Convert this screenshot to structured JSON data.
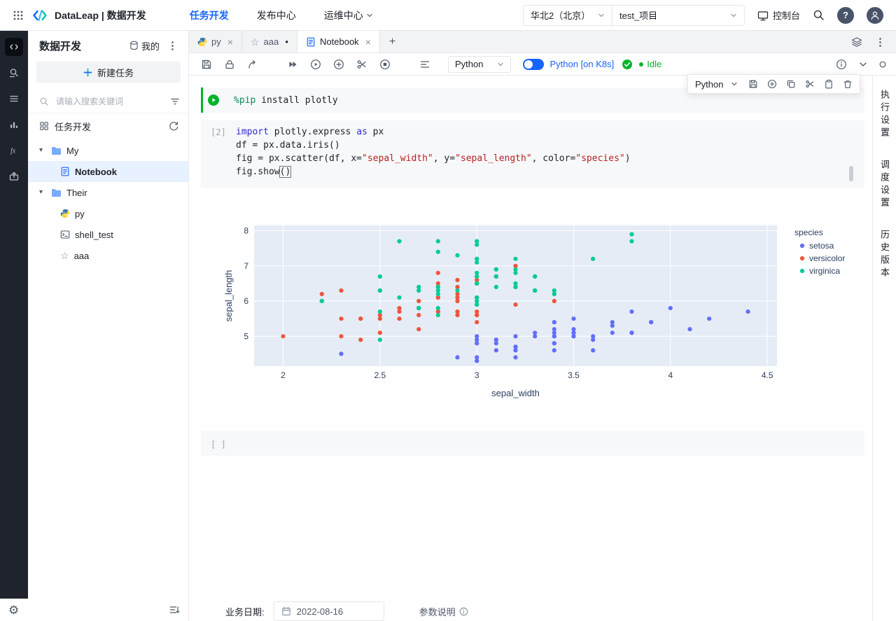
{
  "header": {
    "title": "DataLeap | 数据开发",
    "nav": [
      {
        "label": "任务开发"
      },
      {
        "label": "发布中心"
      },
      {
        "label": "运维中心"
      }
    ],
    "region": "华北2（北京）",
    "project": "test_项目",
    "console": "控制台"
  },
  "sidebar": {
    "title": "数据开发",
    "mine": "我的",
    "new_task": "新建任务",
    "search_placeholder": "请输入搜索关键词",
    "section": "任务开发",
    "tree": {
      "folder1": "My",
      "notebook": "Notebook",
      "folder2": "Their",
      "py": "py",
      "shell": "shell_test",
      "aaa": "aaa"
    }
  },
  "tabs": {
    "py": "py",
    "aaa": "aaa",
    "notebook": "Notebook"
  },
  "toolbar": {
    "kernel": "Python",
    "k8s": "Python [on K8s]",
    "status": "Idle"
  },
  "cell_toolbar": {
    "kernel": "Python"
  },
  "cells": {
    "c1": {
      "tokens": [
        {
          "t": "%pip",
          "c": "magic"
        },
        {
          "t": " install plotly",
          "c": "plain"
        }
      ]
    },
    "c2": {
      "gutter": "[2]",
      "lines": [
        [
          {
            "t": "import",
            "c": "kw"
          },
          {
            "t": " plotly.express ",
            "c": "plain"
          },
          {
            "t": "as",
            "c": "kw"
          },
          {
            "t": " px",
            "c": "plain"
          }
        ],
        [
          {
            "t": "df = px.data.iris()",
            "c": "plain"
          }
        ],
        [
          {
            "t": "fig = px.scatter(df, x=",
            "c": "plain"
          },
          {
            "t": "\"sepal_width\"",
            "c": "str"
          },
          {
            "t": ", y=",
            "c": "plain"
          },
          {
            "t": "\"sepal_length\"",
            "c": "str"
          },
          {
            "t": ", color=",
            "c": "plain"
          },
          {
            "t": "\"species\"",
            "c": "str"
          },
          {
            "t": ")",
            "c": "plain"
          }
        ],
        [
          {
            "t": "fig.show",
            "c": "plain"
          },
          {
            "t": "()",
            "c": "cursor"
          }
        ]
      ]
    },
    "empty_gutter": "[ ]"
  },
  "footer": {
    "date_label": "业务日期:",
    "date_value": "2022-08-16",
    "params": "参数说明"
  },
  "right_panel": {
    "exec": "执行设置",
    "sched": "调度设置",
    "history": "历史版本"
  },
  "icons": {
    "caret": "▾",
    "star": "☆",
    "kebab": "⋮",
    "close": "×",
    "plus": "+",
    "dot": "●",
    "gear": "⚙"
  },
  "colors": {
    "accent_blue": "#1664FF",
    "status_green": "#00B42A"
  },
  "chart_data": {
    "type": "scatter",
    "xlabel": "sepal_width",
    "ylabel": "sepal_length",
    "xlim": [
      1.85,
      4.55
    ],
    "ylim": [
      4.15,
      8.15
    ],
    "xticks": [
      2,
      2.5,
      3,
      3.5,
      4,
      4.5
    ],
    "yticks": [
      5,
      6,
      7,
      8
    ],
    "legend_title": "species",
    "background": "#E5ECF6",
    "grid": true,
    "legend_position": "right",
    "series": [
      {
        "name": "setosa",
        "color": "#636EFA",
        "x": [
          3.5,
          3.0,
          3.2,
          3.1,
          3.6,
          3.9,
          3.4,
          3.4,
          2.9,
          3.1,
          3.7,
          3.4,
          3.0,
          3.0,
          4.0,
          4.4,
          3.9,
          3.5,
          3.8,
          3.8,
          3.4,
          3.7,
          3.6,
          3.3,
          3.4,
          3.0,
          3.4,
          3.5,
          3.4,
          3.2,
          3.1,
          3.4,
          4.1,
          4.2,
          3.1,
          3.2,
          3.5,
          3.6,
          3.0,
          3.4,
          3.5,
          2.3,
          3.2,
          3.5,
          3.8,
          3.0,
          3.8,
          3.2,
          3.7,
          3.3
        ],
        "y": [
          5.1,
          4.9,
          4.7,
          4.6,
          5.0,
          5.4,
          4.6,
          5.0,
          4.4,
          4.9,
          5.4,
          4.8,
          4.8,
          4.3,
          5.8,
          5.7,
          5.4,
          5.1,
          5.7,
          5.1,
          5.4,
          5.1,
          4.6,
          5.1,
          4.8,
          5.0,
          5.0,
          5.2,
          5.2,
          4.7,
          4.8,
          5.4,
          5.2,
          5.5,
          4.9,
          5.0,
          5.5,
          4.9,
          4.4,
          5.1,
          5.0,
          4.5,
          4.4,
          5.0,
          5.1,
          4.8,
          5.1,
          4.6,
          5.3,
          5.0
        ]
      },
      {
        "name": "versicolor",
        "color": "#EF553B",
        "x": [
          3.2,
          3.2,
          3.1,
          2.3,
          2.8,
          2.8,
          3.3,
          2.4,
          2.9,
          2.7,
          2.0,
          3.0,
          2.2,
          2.9,
          2.9,
          3.1,
          3.0,
          2.7,
          2.2,
          2.5,
          3.2,
          2.8,
          2.5,
          2.8,
          2.9,
          3.0,
          2.8,
          3.0,
          2.9,
          2.6,
          2.4,
          2.4,
          2.7,
          2.7,
          3.0,
          3.4,
          3.1,
          2.3,
          3.0,
          2.5,
          2.6,
          3.0,
          2.6,
          2.3,
          2.7,
          3.0,
          2.9,
          2.9,
          2.5,
          2.8
        ],
        "y": [
          7.0,
          6.4,
          6.9,
          5.5,
          6.5,
          5.7,
          6.3,
          4.9,
          6.6,
          5.2,
          5.0,
          5.9,
          6.0,
          6.1,
          5.6,
          6.7,
          5.6,
          5.8,
          6.2,
          5.6,
          5.9,
          6.1,
          6.3,
          6.1,
          6.4,
          6.6,
          6.8,
          6.7,
          6.0,
          5.7,
          5.5,
          5.5,
          5.8,
          6.0,
          5.4,
          6.0,
          6.7,
          6.3,
          5.6,
          5.5,
          5.5,
          6.1,
          5.8,
          5.0,
          5.6,
          5.7,
          5.7,
          6.2,
          5.1,
          5.7
        ]
      },
      {
        "name": "virginica",
        "color": "#00CC96",
        "x": [
          3.3,
          2.7,
          3.0,
          2.9,
          3.0,
          3.0,
          2.5,
          2.9,
          2.5,
          3.6,
          3.2,
          2.7,
          3.0,
          2.5,
          2.8,
          3.2,
          3.0,
          3.8,
          2.6,
          2.2,
          3.2,
          2.8,
          2.8,
          2.7,
          3.3,
          3.2,
          2.8,
          3.0,
          2.8,
          3.0,
          2.8,
          3.8,
          2.8,
          2.8,
          2.6,
          3.0,
          3.4,
          3.1,
          3.0,
          3.1,
          3.1,
          3.1,
          2.7,
          3.2,
          3.3,
          3.0,
          2.5,
          3.0,
          3.4,
          3.0
        ],
        "y": [
          6.3,
          5.8,
          7.1,
          6.3,
          6.5,
          7.6,
          4.9,
          7.3,
          6.7,
          7.2,
          6.5,
          6.4,
          6.8,
          5.7,
          5.8,
          6.4,
          6.5,
          7.7,
          7.7,
          6.0,
          6.9,
          5.6,
          7.7,
          6.3,
          6.7,
          7.2,
          6.2,
          6.1,
          6.4,
          7.2,
          7.4,
          7.9,
          6.4,
          6.3,
          6.1,
          7.7,
          6.3,
          6.4,
          6.0,
          6.9,
          6.7,
          6.9,
          5.8,
          6.8,
          6.7,
          6.7,
          6.3,
          6.5,
          6.2,
          5.9
        ]
      }
    ]
  }
}
